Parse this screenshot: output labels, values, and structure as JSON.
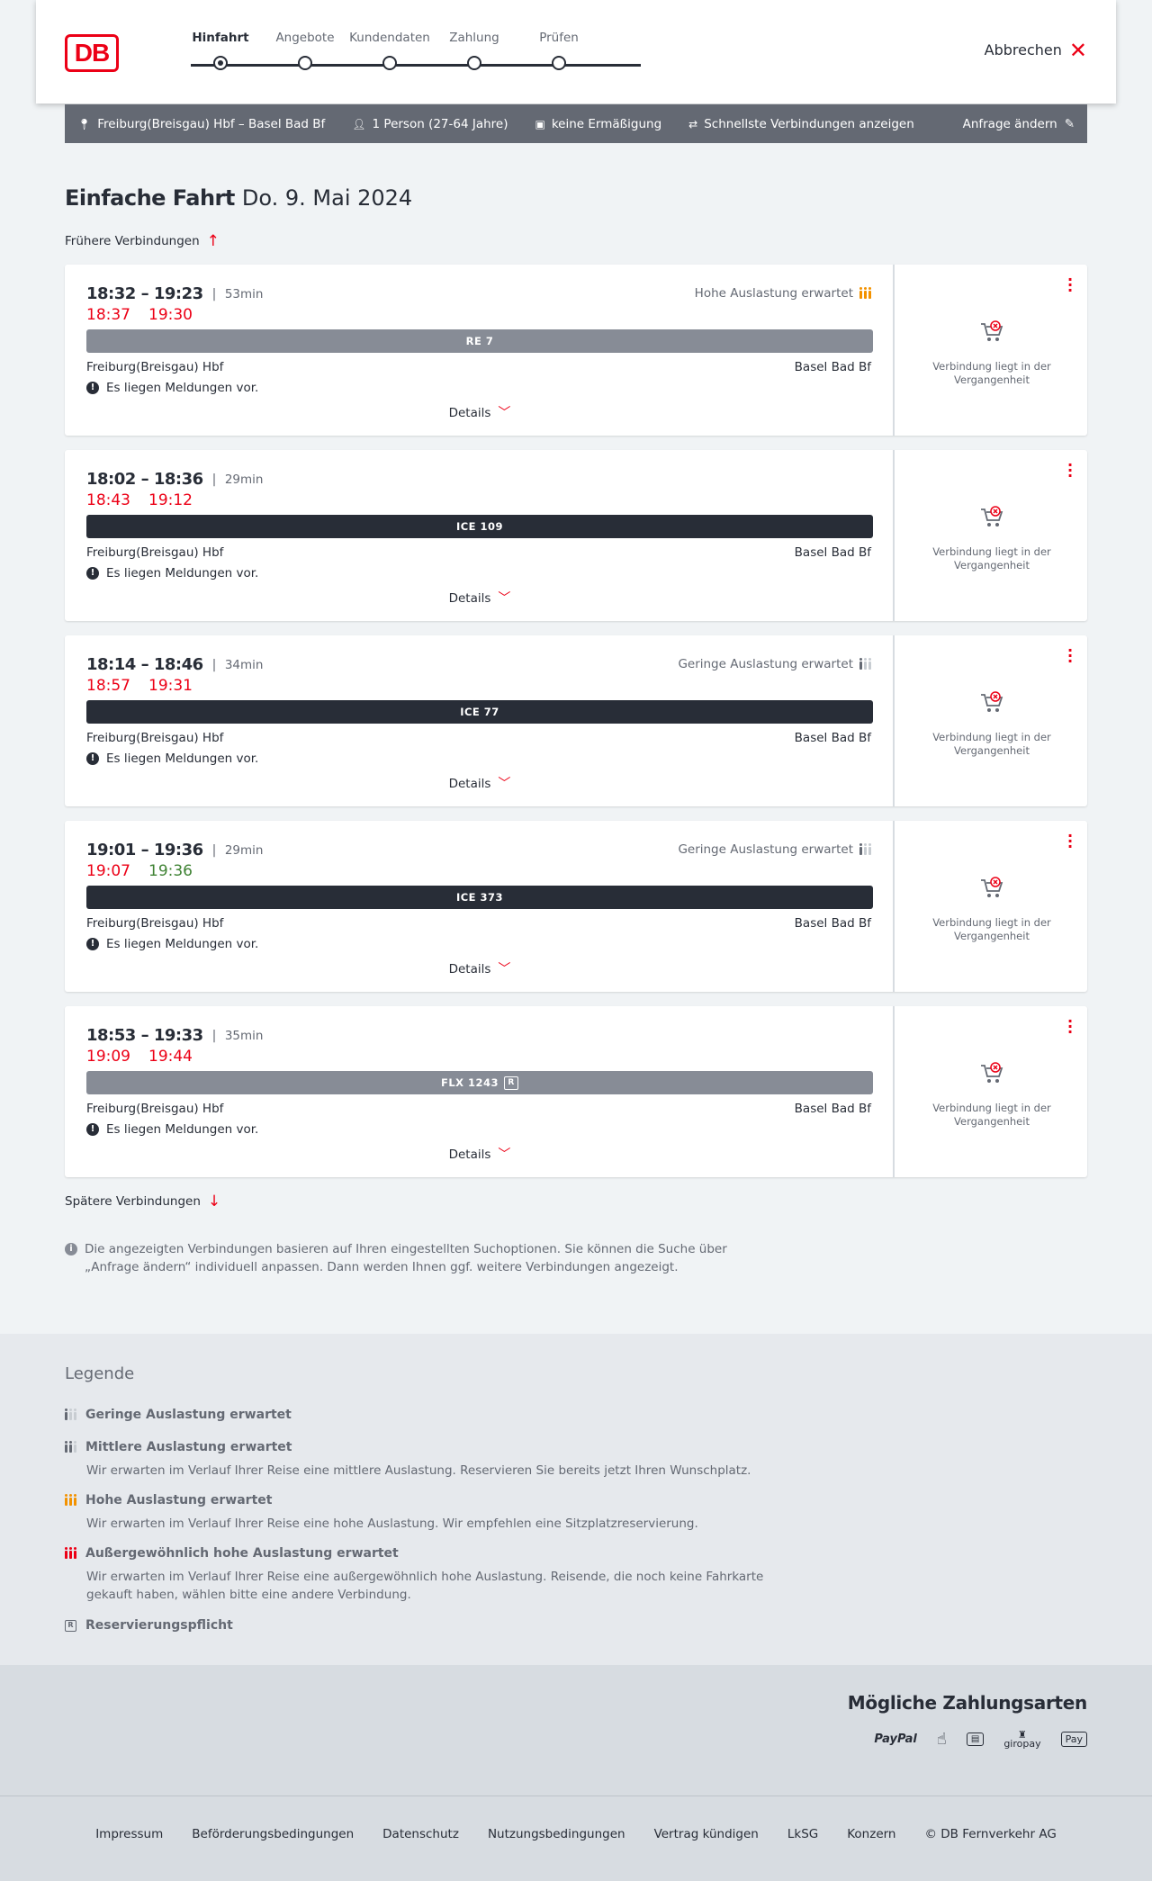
{
  "header": {
    "logo": "DB",
    "steps": [
      "Hinfahrt",
      "Angebote",
      "Kundendaten",
      "Zahlung",
      "Prüfen"
    ],
    "active_step": 0,
    "cancel_label": "Abbrechen"
  },
  "query": {
    "route": "Freiburg(Breisgau) Hbf – Basel Bad Bf",
    "passengers": "1 Person (27-64 Jahre)",
    "discount": "keine Ermäßigung",
    "option": "Schnellste Verbindungen anzeigen",
    "edit_label": "Anfrage ändern"
  },
  "page": {
    "title_bold": "Einfache Fahrt",
    "title_date": "Do. 9. Mai 2024",
    "earlier_label": "Frühere Verbindungen",
    "later_label": "Spätere Verbindungen",
    "info_text": "Die angezeigten Verbindungen basieren auf Ihren eingestellten Suchoptionen. Sie können die Suche über „Anfrage ändern“ individuell anpassen. Dann werden Ihnen ggf. weitere Verbindungen angezeigt."
  },
  "connections": [
    {
      "times": "18:32 – 19:23",
      "duration": "53min",
      "rt_dep": "18:37",
      "rt_dep_color": "#ec0016",
      "rt_arr": "19:30",
      "rt_arr_color": "#ec0016",
      "load": "Hohe Auslastung erwartet",
      "load_level": 3,
      "train": "RE 7",
      "train_color": "#878c96",
      "reservation": false,
      "from": "Freiburg(Breisgau) Hbf",
      "to": "Basel Bad Bf",
      "message": "Es liegen Meldungen vor.",
      "details": "Details",
      "status": "Verbindung liegt in der Vergangenheit"
    },
    {
      "times": "18:02 – 18:36",
      "duration": "29min",
      "rt_dep": "18:43",
      "rt_dep_color": "#ec0016",
      "rt_arr": "19:12",
      "rt_arr_color": "#ec0016",
      "load": "",
      "load_level": 0,
      "train": "ICE 109",
      "train_color": "#282d37",
      "reservation": false,
      "from": "Freiburg(Breisgau) Hbf",
      "to": "Basel Bad Bf",
      "message": "Es liegen Meldungen vor.",
      "details": "Details",
      "status": "Verbindung liegt in der Vergangenheit"
    },
    {
      "times": "18:14 – 18:46",
      "duration": "34min",
      "rt_dep": "18:57",
      "rt_dep_color": "#ec0016",
      "rt_arr": "19:31",
      "rt_arr_color": "#ec0016",
      "load": "Geringe Auslastung erwartet",
      "load_level": 1,
      "train": "ICE 77",
      "train_color": "#282d37",
      "reservation": false,
      "from": "Freiburg(Breisgau) Hbf",
      "to": "Basel Bad Bf",
      "message": "Es liegen Meldungen vor.",
      "details": "Details",
      "status": "Verbindung liegt in der Vergangenheit"
    },
    {
      "times": "19:01 – 19:36",
      "duration": "29min",
      "rt_dep": "19:07",
      "rt_dep_color": "#ec0016",
      "rt_arr": "19:36",
      "rt_arr_color": "#408335",
      "load": "Geringe Auslastung erwartet",
      "load_level": 1,
      "train": "ICE 373",
      "train_color": "#282d37",
      "reservation": false,
      "from": "Freiburg(Breisgau) Hbf",
      "to": "Basel Bad Bf",
      "message": "Es liegen Meldungen vor.",
      "details": "Details",
      "status": "Verbindung liegt in der Vergangenheit"
    },
    {
      "times": "18:53 – 19:33",
      "duration": "35min",
      "rt_dep": "19:09",
      "rt_dep_color": "#ec0016",
      "rt_arr": "19:44",
      "rt_arr_color": "#ec0016",
      "load": "",
      "load_level": 0,
      "train": "FLX 1243",
      "train_color": "#878c96",
      "reservation": true,
      "from": "Freiburg(Breisgau) Hbf",
      "to": "Basel Bad Bf",
      "message": "Es liegen Meldungen vor.",
      "details": "Details",
      "status": "Verbindung liegt in der Vergangenheit"
    }
  ],
  "legend": {
    "title": "Legende",
    "items": [
      {
        "title": "Geringe Auslastung erwartet",
        "desc": ""
      },
      {
        "title": "Mittlere Auslastung erwartet",
        "desc": "Wir erwarten im Verlauf Ihrer Reise eine mittlere Auslastung. Reservieren Sie bereits jetzt Ihren Wunschplatz."
      },
      {
        "title": "Hohe Auslastung erwartet",
        "desc": "Wir erwarten im Verlauf Ihrer Reise eine hohe Auslastung. Wir empfehlen eine Sitzplatzreservierung."
      },
      {
        "title": "Außergewöhnlich hohe Auslastung erwartet",
        "desc": "Wir erwarten im Verlauf Ihrer Reise eine außergewöhnlich hohe Auslastung. Reisende, die noch keine Fahrkarte gekauft haben, wählen bitte eine andere Verbindung."
      },
      {
        "title": "Reservierungspflicht",
        "desc": ""
      }
    ]
  },
  "payment": {
    "title": "Mögliche Zahlungsarten",
    "methods": [
      "PayPal",
      "giropay",
      "Pay"
    ]
  },
  "footer": {
    "links": [
      "Impressum",
      "Beförderungsbedingungen",
      "Datenschutz",
      "Nutzungsbedingungen",
      "Vertrag kündigen",
      "LkSG",
      "Konzern",
      "© DB Fernverkehr AG"
    ]
  },
  "colors": {
    "accent": "#ec0016",
    "dark": "#282d37",
    "muted": "#646973",
    "load_high": "#f39200"
  }
}
